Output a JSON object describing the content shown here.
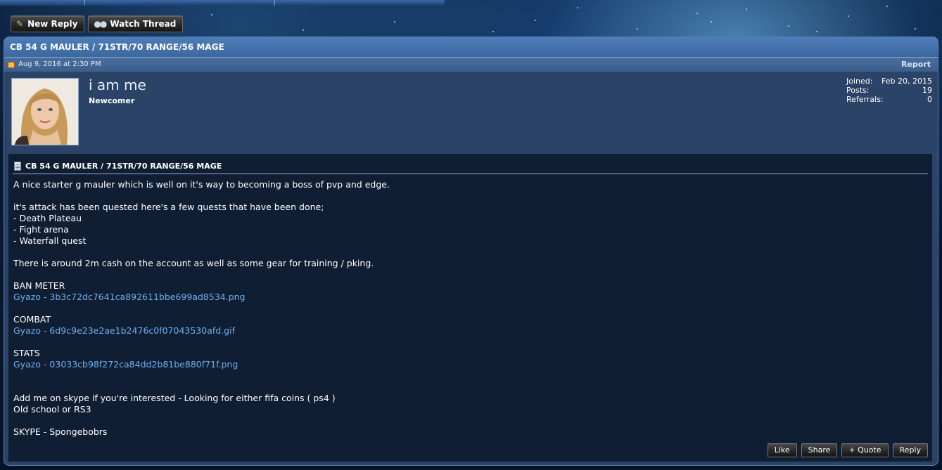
{
  "toolbar": {
    "new_reply_label": "New Reply",
    "watch_thread_label": "Watch Thread"
  },
  "thread": {
    "title": "CB 54 G MAULER / 71STR/70 RANGE/56 MAGE"
  },
  "post": {
    "date": "Aug 9, 2016 at 2:30 PM",
    "report_label": "Report",
    "user": {
      "name": "i am me",
      "title": "Newcomer",
      "stats": [
        {
          "label": "Joined:",
          "value": "Feb 20, 2015"
        },
        {
          "label": "Posts:",
          "value": "19"
        },
        {
          "label": "Referrals:",
          "value": "0"
        }
      ]
    },
    "message_title": "CB 54 G MAULER / 71STR/70 RANGE/56 MAGE",
    "lines": [
      {
        "text": "A nice starter g mauler which is well on it's way to becoming a boss of pvp and edge.",
        "link": false
      },
      {
        "text": "",
        "link": false
      },
      {
        "text": "it's attack has been quested here's a few quests that have been done;",
        "link": false
      },
      {
        "text": "- Death Plateau",
        "link": false
      },
      {
        "text": "- Fight arena",
        "link": false
      },
      {
        "text": "- Waterfall quest",
        "link": false
      },
      {
        "text": "",
        "link": false
      },
      {
        "text": "There is around 2m cash on the account as well as some gear for training / pking.",
        "link": false
      },
      {
        "text": "",
        "link": false
      },
      {
        "text": "BAN METER",
        "link": false
      },
      {
        "text": "Gyazo - 3b3c72dc7641ca892611bbe699ad8534.png",
        "link": true
      },
      {
        "text": "",
        "link": false
      },
      {
        "text": "COMBAT",
        "link": false
      },
      {
        "text": "Gyazo - 6d9c9e23e2ae1b2476c0f07043530afd.gif",
        "link": true
      },
      {
        "text": "",
        "link": false
      },
      {
        "text": "STATS",
        "link": false
      },
      {
        "text": "Gyazo - 03033cb98f272ca84dd2b81be880f71f.png",
        "link": true
      },
      {
        "text": "",
        "link": false
      },
      {
        "text": "",
        "link": false
      },
      {
        "text": "Add me on skype if you're interested - Looking for either fifa coins ( ps4 )",
        "link": false
      },
      {
        "text": "Old school or RS3",
        "link": false
      },
      {
        "text": "",
        "link": false
      },
      {
        "text": "SKYPE - Spongebobrs",
        "link": false
      }
    ],
    "actions": {
      "like": "Like",
      "share": "Share",
      "quote": "+ Quote",
      "reply": "Reply"
    }
  },
  "colors": {
    "panel": "#2a4366",
    "title_bar": "#4f7db8",
    "message_bg": "#0f1e33",
    "link": "#6fb0f0"
  },
  "icons": [
    "reply-icon",
    "binoculars-icon",
    "post-icon",
    "document-icon"
  ]
}
